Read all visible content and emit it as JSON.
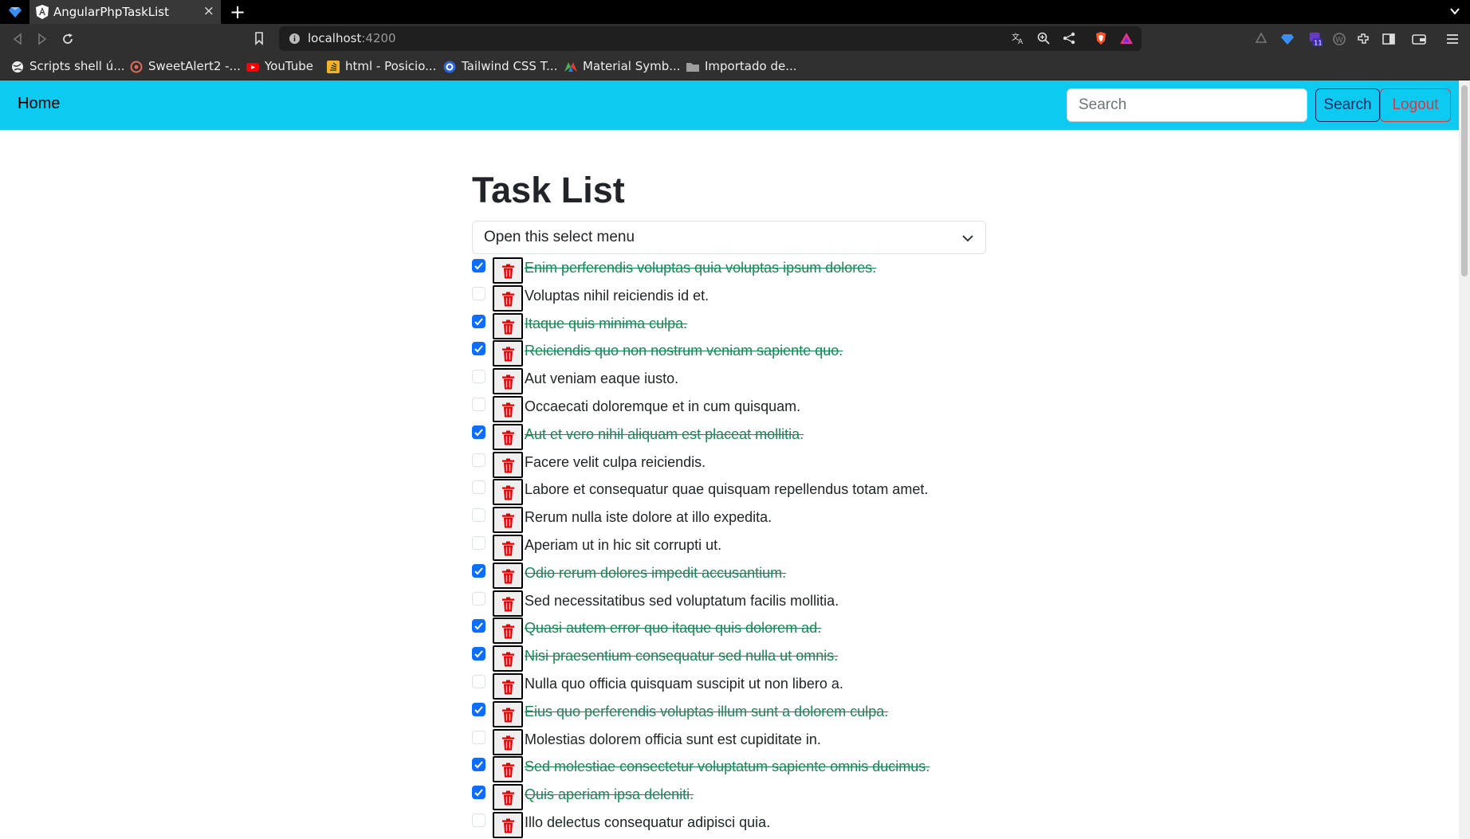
{
  "browser": {
    "tab_title": "AngularPhpTaskList",
    "tab_close": "×",
    "new_tab": "+",
    "url_host": "localhost",
    "url_port": ":4200",
    "extension_badge": "11",
    "bookmarks": [
      {
        "label": "Scripts shell ú...",
        "color": "#ffffff"
      },
      {
        "label": "SweetAlert2 -...",
        "color": "#e06c5a"
      },
      {
        "label": "YouTube",
        "color": "#ff0000"
      },
      {
        "label": "html - Posicio...",
        "color": "#f2b12a"
      },
      {
        "label": "Tailwind CSS T...",
        "color": "#2a66d9"
      },
      {
        "label": "Material Symb...",
        "color": "#4caf50"
      },
      {
        "label": "Importado de...",
        "color": "#9e9e9e"
      }
    ]
  },
  "navbar": {
    "brand": "Home",
    "search_placeholder": "Search",
    "search_button": "Search",
    "logout_button": "Logout",
    "bg_color": "#0dcaf0"
  },
  "main": {
    "title": "Task List",
    "select_label": "Open this select menu",
    "tasks": [
      {
        "text": "Enim perferendis voluptas quia voluptas ipsum dolores.",
        "done": true
      },
      {
        "text": "Voluptas nihil reiciendis id et.",
        "done": false
      },
      {
        "text": "Itaque quis minima culpa.",
        "done": true
      },
      {
        "text": "Reiciendis quo non nostrum veniam sapiente quo.",
        "done": true
      },
      {
        "text": "Aut veniam eaque iusto.",
        "done": false
      },
      {
        "text": "Occaecati doloremque et in cum quisquam.",
        "done": false
      },
      {
        "text": "Aut et vero nihil aliquam est placeat mollitia.",
        "done": true
      },
      {
        "text": "Facere velit culpa reiciendis.",
        "done": false
      },
      {
        "text": "Labore et consequatur quae quisquam repellendus totam amet.",
        "done": false
      },
      {
        "text": "Rerum nulla iste dolore at illo expedita.",
        "done": false
      },
      {
        "text": "Aperiam ut in hic sit corrupti ut.",
        "done": false
      },
      {
        "text": "Odio rerum dolores impedit accusantium.",
        "done": true
      },
      {
        "text": "Sed necessitatibus sed voluptatum facilis mollitia.",
        "done": false
      },
      {
        "text": "Quasi autem error quo itaque quis dolorem ad.",
        "done": true
      },
      {
        "text": "Nisi praesentium consequatur sed nulla ut omnis.",
        "done": true
      },
      {
        "text": "Nulla quo officia quisquam suscipit ut non libero a.",
        "done": false
      },
      {
        "text": "Eius quo perferendis voluptas illum sunt a dolorem culpa.",
        "done": true
      },
      {
        "text": "Molestias dolorem officia sunt est cupiditate in.",
        "done": false
      },
      {
        "text": "Sed molestiae consectetur voluptatum sapiente omnis ducimus.",
        "done": true
      },
      {
        "text": "Quis aperiam ipsa deleniti.",
        "done": true
      },
      {
        "text": "Illo delectus consequatur adipisci quia.",
        "done": false
      }
    ]
  },
  "colors": {
    "done_text": "#198754",
    "checkbox_on": "#0d6efd",
    "delete_icon": "#e00000"
  }
}
